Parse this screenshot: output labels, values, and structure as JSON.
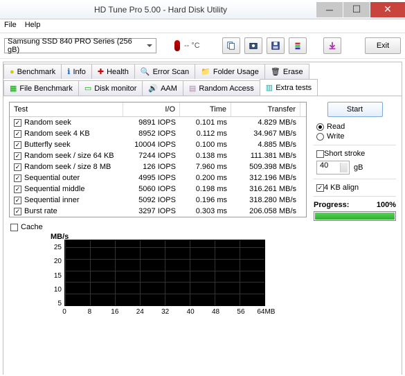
{
  "window": {
    "title": "HD Tune Pro 5.00 - Hard Disk Utility"
  },
  "menu": {
    "file": "File",
    "help": "Help"
  },
  "toolbar": {
    "drive": "Samsung SSD 840 PRO Series (256 gB)",
    "temp": "-- °C",
    "exit": "Exit"
  },
  "tabs_row1": [
    {
      "label": "Benchmark"
    },
    {
      "label": "Info"
    },
    {
      "label": "Health"
    },
    {
      "label": "Error Scan"
    },
    {
      "label": "Folder Usage"
    },
    {
      "label": "Erase"
    }
  ],
  "tabs_row2": [
    {
      "label": "File Benchmark"
    },
    {
      "label": "Disk monitor"
    },
    {
      "label": "AAM"
    },
    {
      "label": "Random Access"
    },
    {
      "label": "Extra tests"
    }
  ],
  "grid": {
    "headers": {
      "test": "Test",
      "io": "I/O",
      "time": "Time",
      "transfer": "Transfer"
    },
    "rows": [
      {
        "name": "Random seek",
        "io": "9891 IOPS",
        "time": "0.101 ms",
        "xfer": "4.829 MB/s"
      },
      {
        "name": "Random seek 4 KB",
        "io": "8952 IOPS",
        "time": "0.112 ms",
        "xfer": "34.967 MB/s"
      },
      {
        "name": "Butterfly seek",
        "io": "10004 IOPS",
        "time": "0.100 ms",
        "xfer": "4.885 MB/s"
      },
      {
        "name": "Random seek / size 64 KB",
        "io": "7244 IOPS",
        "time": "0.138 ms",
        "xfer": "111.381 MB/s"
      },
      {
        "name": "Random seek / size 8 MB",
        "io": "126 IOPS",
        "time": "7.960 ms",
        "xfer": "509.398 MB/s"
      },
      {
        "name": "Sequential outer",
        "io": "4995 IOPS",
        "time": "0.200 ms",
        "xfer": "312.196 MB/s"
      },
      {
        "name": "Sequential middle",
        "io": "5060 IOPS",
        "time": "0.198 ms",
        "xfer": "316.261 MB/s"
      },
      {
        "name": "Sequential inner",
        "io": "5092 IOPS",
        "time": "0.196 ms",
        "xfer": "318.280 MB/s"
      },
      {
        "name": "Burst rate",
        "io": "3297 IOPS",
        "time": "0.303 ms",
        "xfer": "206.058 MB/s"
      }
    ]
  },
  "side": {
    "start": "Start",
    "read": "Read",
    "write": "Write",
    "short": "Short stroke",
    "stroke_val": "40",
    "stroke_unit": "gB",
    "align": "4 KB align",
    "progress": "Progress:",
    "progress_val": "100%"
  },
  "cache": "Cache",
  "chart_data": {
    "type": "line",
    "ylabel": "MB/s",
    "xlim": [
      0,
      64
    ],
    "ylim": [
      0,
      28
    ],
    "yticks": [
      5,
      10,
      15,
      20,
      25
    ],
    "xticks": [
      0,
      8,
      16,
      24,
      32,
      40,
      48,
      56
    ],
    "xmax_label": "64MB",
    "x": [],
    "y": []
  }
}
